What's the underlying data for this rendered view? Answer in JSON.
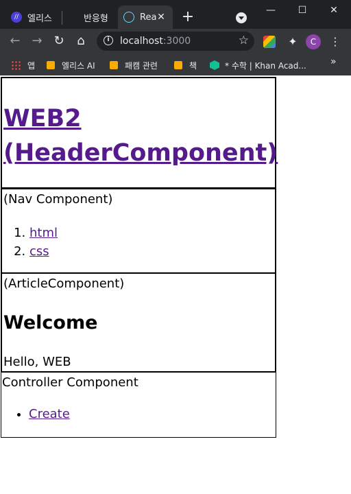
{
  "browser": {
    "tabs": [
      {
        "title": "엘리스",
        "active": false
      },
      {
        "title": "반응형",
        "active": false
      },
      {
        "title": "Rea",
        "active": true
      }
    ],
    "address": {
      "host": "localhost",
      "port": ":3000"
    },
    "bookmarks": [
      {
        "label": "앱"
      },
      {
        "label": "엘리스 AI"
      },
      {
        "label": "패캠 관련"
      },
      {
        "label": "책"
      },
      {
        "label": "* 수학 | Khan Acad..."
      }
    ],
    "profile_initial": "C",
    "colors": {
      "frame": "#202124",
      "toolbar": "#35363a",
      "avatar": "#8e44ad"
    }
  },
  "page": {
    "header": {
      "title": "WEB2 (HeaderComponent)"
    },
    "nav": {
      "label": "(Nav Component)",
      "items": [
        "html",
        "css"
      ]
    },
    "article": {
      "label": "(ArticleComponent)",
      "heading": "Welcome",
      "body": "Hello, WEB"
    },
    "controller": {
      "label": "Controller Component",
      "items": [
        "Create"
      ]
    },
    "colors": {
      "link": "#551a8b",
      "border": "#000000"
    }
  }
}
